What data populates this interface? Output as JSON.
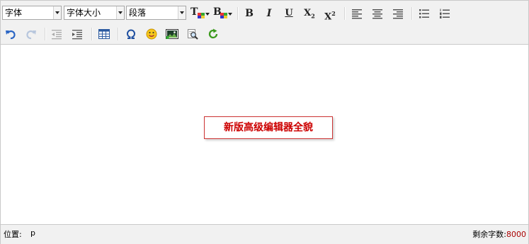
{
  "toolbar": {
    "font_family": "字体",
    "font_size": "字体大小",
    "paragraph": "段落",
    "bold": "B",
    "italic": "I",
    "underline": "U",
    "subscript": "X",
    "subscript_mark": "2",
    "superscript": "X",
    "superscript_mark": "2",
    "fore_color": "T",
    "back_color": "B"
  },
  "content": {
    "notice": "新版高级编辑器全貌"
  },
  "status": {
    "position_label": "位置:",
    "path": "p",
    "remaining_label": "剩余字数:",
    "remaining_count": "8000"
  },
  "icons": [
    "text-color-icon",
    "background-color-icon",
    "align-left-icon",
    "align-center-icon",
    "align-right-icon",
    "unordered-list-icon",
    "ordered-list-icon",
    "undo-icon",
    "redo-icon",
    "outdent-icon",
    "indent-icon",
    "table-icon",
    "special-char-icon",
    "emoticon-icon",
    "image-icon",
    "find-replace-icon",
    "refresh-icon"
  ],
  "colors": {
    "notice_text": "#cc0000",
    "notice_border": "#cc3333",
    "count": "#aa0000",
    "toolbar_bg": "#f1f1f1"
  }
}
